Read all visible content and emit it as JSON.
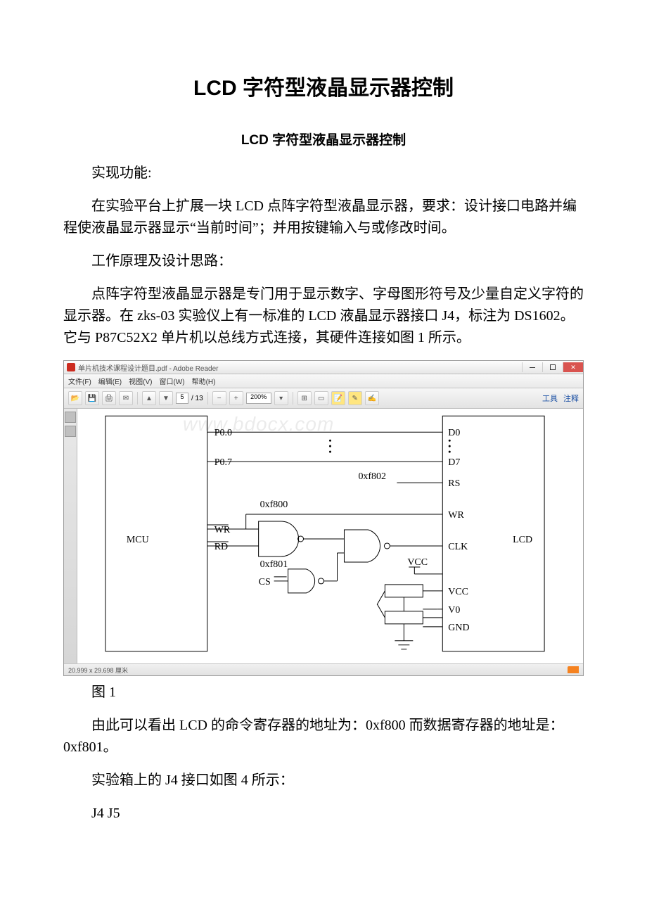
{
  "title_main": "LCD 字符型液晶显示器控制",
  "title_sub": "LCD 字符型液晶显示器控制",
  "p1": "实现功能:",
  "p2": "在实验平台上扩展一块 LCD 点阵字符型液晶显示器，要求：设计接口电路并编程使液晶显示器显示“当前时间”；并用按键输入与或修改时间。",
  "p3": "工作原理及设计思路：",
  "p4": "点阵字符型液晶显示器是专门用于显示数字、字母图形符号及少量自定义字符的显示器。在 zks-03 实验仪上有一标准的 LCD 液晶显示器接口 J4，标注为 DS1602。它与 P87C52X2 单片机以总线方式连接，其硬件连接如图 1 所示。",
  "fig_caption": "图 1",
  "p5": "由此可以看出 LCD 的命令寄存器的地址为：0xf800 而数据寄存器的地址是：0xf801。",
  "p6": "实验箱上的 J4 接口如图 4 所示：",
  "p7": "J4 J5",
  "adobe": {
    "title": "单片机技术课程设计题目.pdf - Adobe Reader",
    "menus": [
      "文件(F)",
      "编辑(E)",
      "视图(V)",
      "窗口(W)",
      "帮助(H)"
    ],
    "page_current": "5",
    "page_total": "/ 13",
    "zoom": "200%",
    "right_links": [
      "工具",
      "注释"
    ],
    "status": "20.999 x 29.698 厘米"
  },
  "diagram": {
    "left_block": "MCU",
    "right_block": "LCD",
    "left_pins": [
      "P0.0",
      "P0.7",
      "WR",
      "RD"
    ],
    "mid_labels": [
      "0xf802",
      "0xf800",
      "0xf801",
      "CS"
    ],
    "right_pins": [
      "D0",
      "D7",
      "RS",
      "WR",
      "CLK",
      "VCC",
      "VCC",
      "V0",
      "GND"
    ]
  },
  "watermark": "www.bdocx.com"
}
